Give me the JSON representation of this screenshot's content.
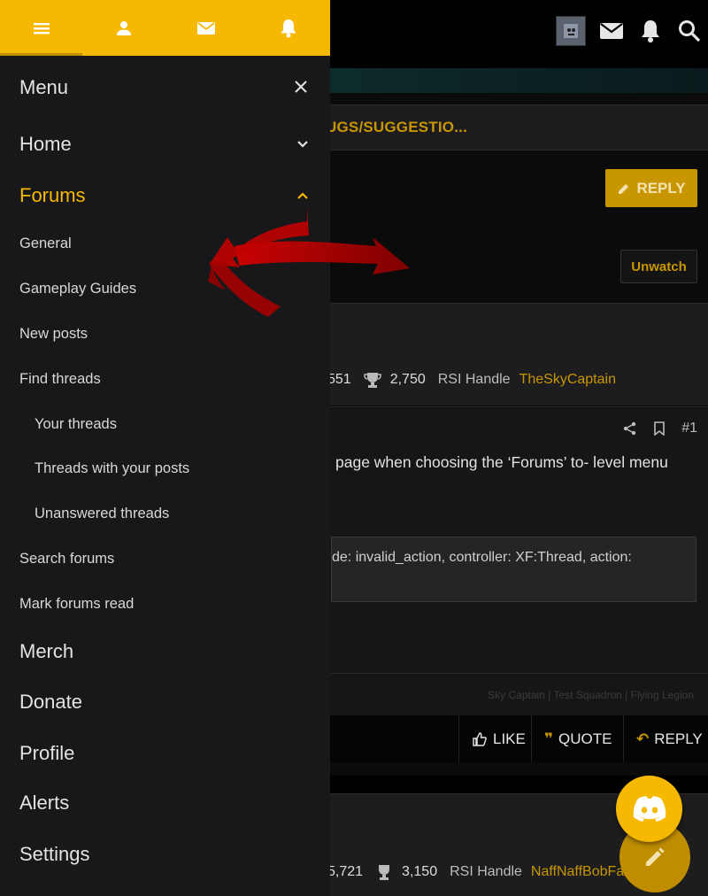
{
  "colors": {
    "accent": "#f6b800",
    "accent_dark": "#c89600",
    "drawer_bg": "#18181a",
    "arrow_red": "#b80000"
  },
  "drawer": {
    "tabs": [
      {
        "icon": "hamburger-icon",
        "active": true
      },
      {
        "icon": "user-icon",
        "active": false
      },
      {
        "icon": "envelope-icon",
        "active": false
      },
      {
        "icon": "bell-icon",
        "active": false
      }
    ],
    "title": "Menu",
    "items": {
      "home": "Home",
      "forums": "Forums",
      "general": "General",
      "gameplay_guides": "Gameplay Guides",
      "new_posts": "New posts",
      "find_threads": "Find threads",
      "your_threads": "Your threads",
      "threads_with_your_posts": "Threads with your posts",
      "unanswered_threads": "Unanswered threads",
      "search_forums": "Search forums",
      "mark_forums_read": "Mark forums read",
      "merch": "Merch",
      "donate": "Donate",
      "profile": "Profile",
      "alerts": "Alerts",
      "settings": "Settings"
    }
  },
  "page": {
    "breadcrumb": "UGS/SUGGESTIO...",
    "reply_button": "REPLY",
    "unwatch_button": "Unwatch",
    "post1": {
      "messages": "551",
      "points": "2,750",
      "rsi_label": "RSI Handle",
      "rsi_handle": "TheSkyCaptain",
      "post_number": "#1",
      "text": "page when choosing the ‘Forums’ to- level menu",
      "error_text": "de: invalid_action, controller: XF:Thread, action:",
      "signature": "Sky Captain | Test Squadron | Flying Legion"
    },
    "actions": {
      "like": "LIKE",
      "quote": "QUOTE",
      "reply": "REPLY"
    },
    "post2": {
      "messages": "5,721",
      "points": "3,150",
      "rsi_label": "RSI Handle",
      "rsi_handle": "NaffNaffBobFa"
    }
  }
}
